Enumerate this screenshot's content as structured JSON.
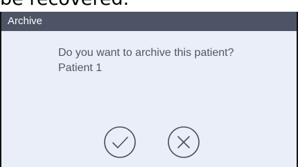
{
  "background": {
    "partial_text": "be recovered."
  },
  "dialog": {
    "title": "Archive",
    "message": "Do you want to archive this patient?",
    "patient_name": "Patient 1",
    "buttons": {
      "confirm_icon": "checkmark-icon",
      "cancel_icon": "x-icon"
    },
    "colors": {
      "titlebar": "#4d5465",
      "body": "#e9eef8",
      "text": "#53565c",
      "icon_stroke": "#4a4f5c"
    }
  }
}
